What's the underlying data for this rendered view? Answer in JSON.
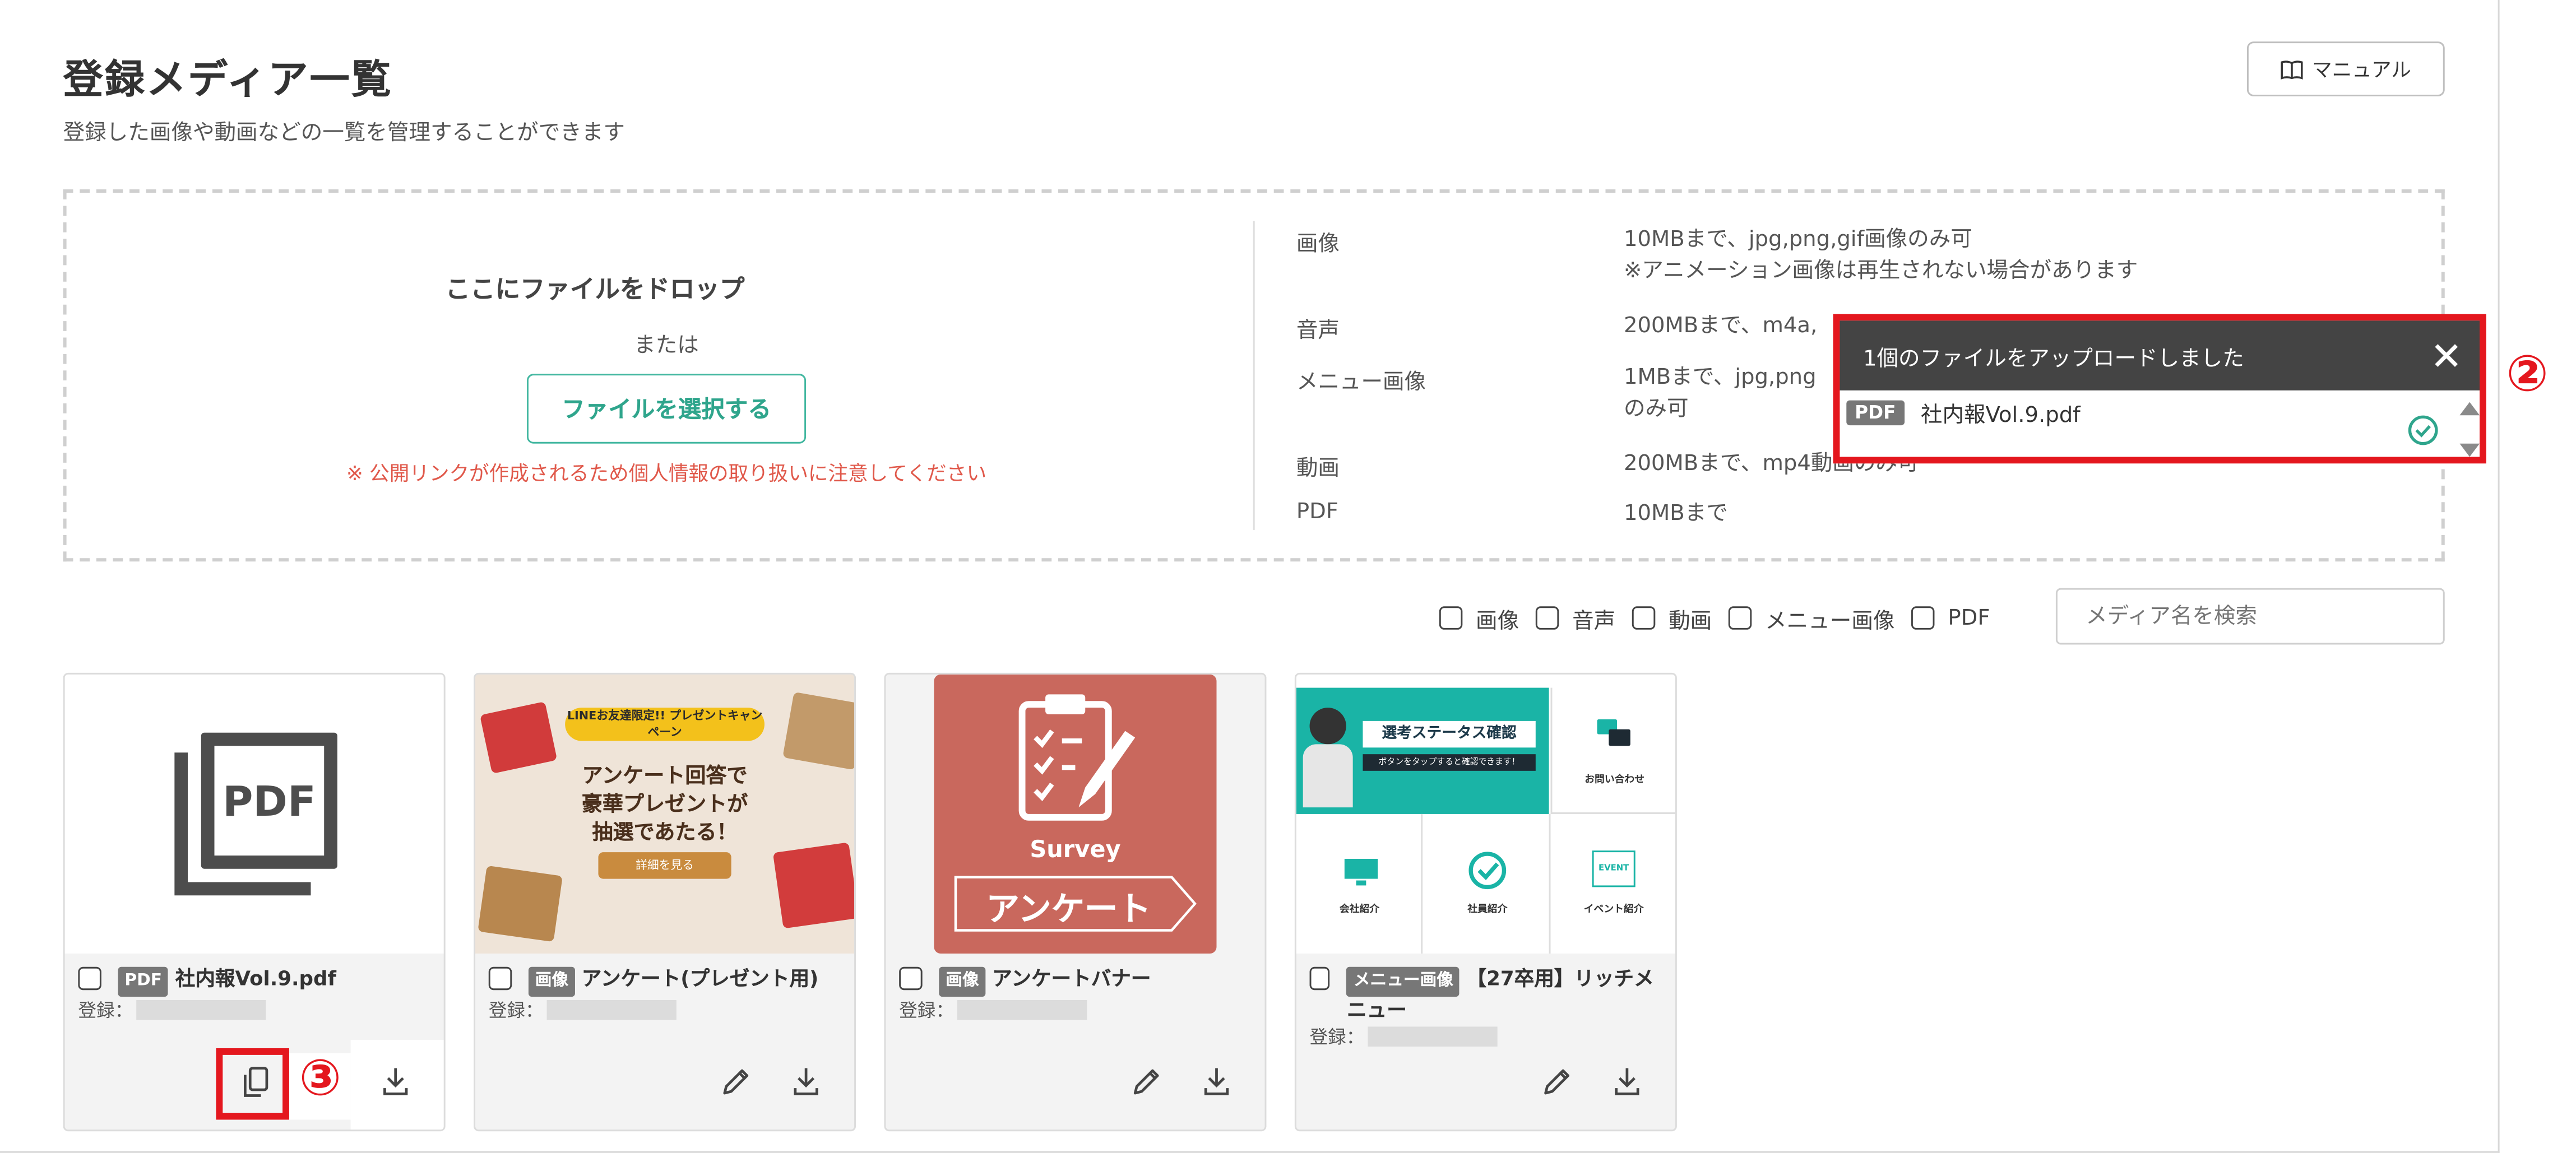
{
  "page": {
    "title": "登録メディア一覧",
    "subtitle": "登録した画像や動画などの一覧を管理することができます",
    "manual_label": "マニュアル"
  },
  "dropzone": {
    "title": "ここにファイルをドロップ",
    "or": "または",
    "select_button": "ファイルを選択する",
    "note": "※ 公開リンクが作成されるため個人情報の取り扱いに注意してください"
  },
  "specs": [
    {
      "type": "画像",
      "line1": "10MBまで、jpg,png,gif画像のみ可",
      "line2": "※アニメーション画像は再生されない場合があります"
    },
    {
      "type": "音声",
      "line1": "200MBまで、m4a,",
      "line2": ""
    },
    {
      "type": "メニュー画像",
      "line1": "1MBまで、jpg,png",
      "line2": "のみ可"
    },
    {
      "type": "動画",
      "line1": "200MBまで、mp4動画のみ可",
      "line2": ""
    },
    {
      "type": "PDF",
      "line1": "10MBまで",
      "line2": ""
    }
  ],
  "filters": [
    "画像",
    "音声",
    "動画",
    "メニュー画像",
    "PDF"
  ],
  "search": {
    "placeholder": "メディア名を検索"
  },
  "cards": [
    {
      "tag": "PDF",
      "name": "社内報Vol.9.pdf",
      "registered_label": "登録："
    },
    {
      "tag": "画像",
      "name": "アンケート(プレゼント用)",
      "registered_label": "登録：",
      "thumb": {
        "badge": "LINEお友達限定!! プレゼントキャンペーン",
        "headline1": "アンケート回答で",
        "headline2": "豪華プレゼントが",
        "headline3": "抽選であたる！",
        "cta": "詳細を見る"
      }
    },
    {
      "tag": "画像",
      "name": "アンケートバナー",
      "registered_label": "登録：",
      "thumb": {
        "word_en": "Survey",
        "word_ja": "アンケート"
      }
    },
    {
      "tag": "メニュー画像",
      "name": "【27卒用】リッチメニュー",
      "registered_label": "登録：",
      "thumb": {
        "cell1_title": "選考ステータス確認",
        "cell1_sub": "ボタンをタップすると確認できます！",
        "cell2": "お問い合わせ",
        "cell3": "会社紹介",
        "cell4": "社員紹介",
        "cell5": "イベント紹介",
        "mini_logo": "EVENT"
      }
    }
  ],
  "toast": {
    "title": "1個のファイルをアップロードしました",
    "file_tag": "PDF",
    "file_name": "社内報Vol.9.pdf"
  },
  "annotations": {
    "circle2": "②",
    "circle3": "③"
  },
  "colors": {
    "accent": "#42b7a0",
    "warning": "#e0584a",
    "highlight": "#e4171e",
    "survey_bg": "#c9685d",
    "menu_teal": "#1ab4a6"
  }
}
